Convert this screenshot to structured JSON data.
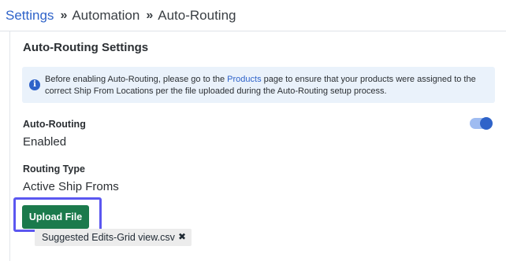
{
  "breadcrumb": {
    "items": [
      "Settings",
      "Automation",
      "Auto-Routing"
    ],
    "separator": "»"
  },
  "section": {
    "title": "Auto-Routing Settings"
  },
  "info": {
    "icon": "info-icon",
    "text_before": "Before enabling Auto-Routing, please go to the ",
    "link_text": "Products",
    "text_after": " page to ensure that your products were assigned to the correct Ship From Locations per the file uploaded during the Auto-Routing setup process."
  },
  "auto_routing": {
    "label": "Auto-Routing",
    "value": "Enabled",
    "toggle_on": true
  },
  "routing_type": {
    "label": "Routing Type",
    "value": "Active Ship Froms"
  },
  "upload": {
    "button_label": "Upload File",
    "file_name": "Suggested Edits-Grid view.csv",
    "remove_glyph": "✖"
  },
  "colors": {
    "link": "#2f63c9",
    "button": "#1b7a4c",
    "highlight": "#5b57f0",
    "info_bg": "#eaf2fb"
  }
}
